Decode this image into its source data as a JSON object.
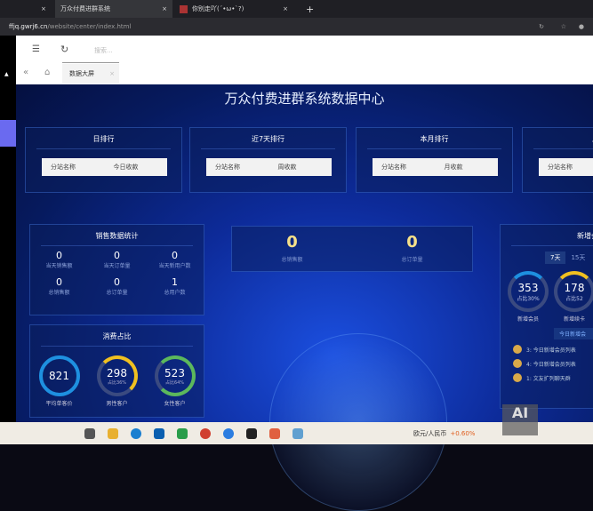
{
  "browser": {
    "tabs": [
      {
        "label": "万众付费进群系统"
      },
      {
        "label": "你别走吖(´•ω•`?)"
      }
    ],
    "new_tab": "+",
    "url_host": "ffjq.gwrj6.cn",
    "url_path": "/website/center/index.html"
  },
  "app": {
    "search_placeholder": "搜索...",
    "page_tab": "数据大屏",
    "close": "×"
  },
  "dashboard": {
    "title": "万众付费进群系统数据中心",
    "rankings": [
      {
        "title": "日排行",
        "col1": "分站名称",
        "col2": "今日收款"
      },
      {
        "title": "近7天排行",
        "col1": "分站名称",
        "col2": "周收款"
      },
      {
        "title": "本月排行",
        "col1": "分站名称",
        "col2": "月收款"
      },
      {
        "title": "总",
        "col1": "分站名称",
        "col2": ""
      }
    ],
    "sales": {
      "title": "销售数据统计",
      "items": [
        {
          "value": "0",
          "label": "当天销售额"
        },
        {
          "value": "0",
          "label": "当天订单量"
        },
        {
          "value": "0",
          "label": "当天新用户数"
        },
        {
          "value": "0",
          "label": "总销售额"
        },
        {
          "value": "0",
          "label": "总订单量"
        },
        {
          "value": "1",
          "label": "总用户数"
        }
      ]
    },
    "consumption": {
      "title": "消费占比",
      "items": [
        {
          "value": "821",
          "sub": "",
          "label": "平均单客价",
          "color": "#1e90e0"
        },
        {
          "value": "298",
          "sub": "占比36%",
          "label": "男性客户",
          "color": "#f0c020"
        },
        {
          "value": "523",
          "sub": "占比64%",
          "label": "女性客户",
          "color": "#5cb85c"
        }
      ]
    },
    "center": [
      {
        "value": "0",
        "label": "总销售额"
      },
      {
        "value": "0",
        "label": "总订单量"
      }
    ],
    "members": {
      "title": "新增会员",
      "tabs": [
        "7天",
        "15天"
      ],
      "rings": [
        {
          "value": "353",
          "sub": "占比30%",
          "label": "新增会员"
        },
        {
          "value": "178",
          "sub": "占比52",
          "label": "新增续卡"
        }
      ],
      "today_label": "今日新增会",
      "list": [
        "3: 今日新增会员列表",
        "4: 今日新增会员列表",
        "1: 文友扩列聊天群"
      ]
    }
  },
  "taskbar": {
    "ticker": "欧元/人民币",
    "change": "+0.60%"
  },
  "watermark": "AI 树叶云"
}
